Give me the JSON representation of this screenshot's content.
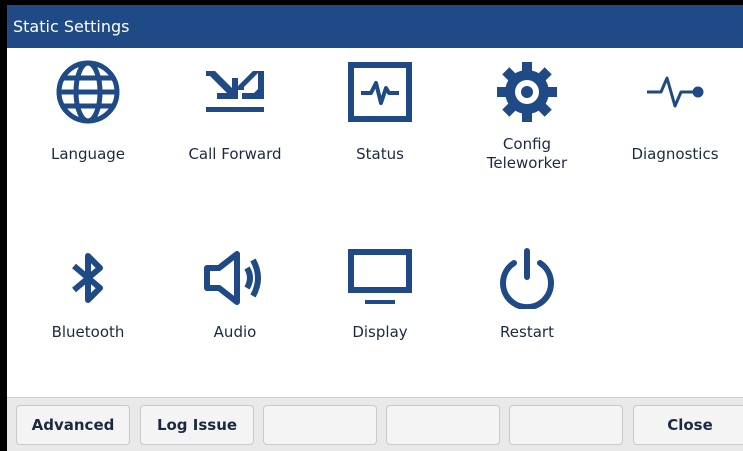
{
  "window": {
    "title": "Static Settings"
  },
  "colors": {
    "titlebar": "#1f4a85",
    "icon": "#1f4a85"
  },
  "tiles": [
    {
      "label": "Language",
      "icon": "globe-icon"
    },
    {
      "label": "Call Forward",
      "icon": "call-forward-icon"
    },
    {
      "label": "Status",
      "icon": "status-icon"
    },
    {
      "label": "Config\nTeleworker",
      "icon": "gear-icon"
    },
    {
      "label": "Diagnostics",
      "icon": "diagnostics-icon"
    },
    {
      "label": "Bluetooth",
      "icon": "bluetooth-icon"
    },
    {
      "label": "Audio",
      "icon": "speaker-icon"
    },
    {
      "label": "Display",
      "icon": "monitor-icon"
    },
    {
      "label": "Restart",
      "icon": "power-icon"
    }
  ],
  "softkeys": [
    {
      "label": "Advanced"
    },
    {
      "label": "Log Issue"
    },
    {
      "label": ""
    },
    {
      "label": ""
    },
    {
      "label": ""
    },
    {
      "label": "Close"
    }
  ]
}
